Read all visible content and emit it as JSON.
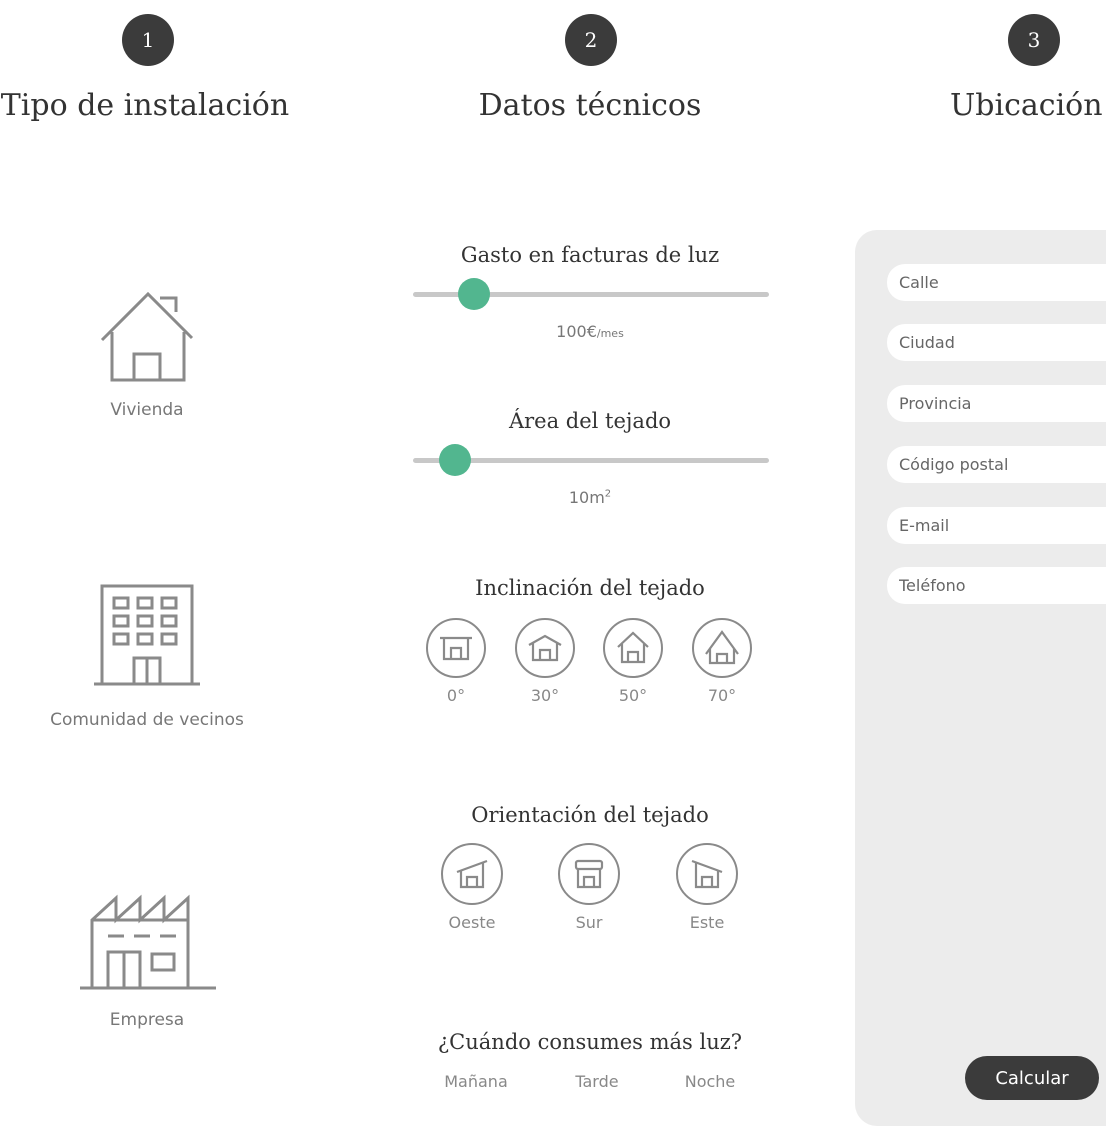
{
  "steps": [
    {
      "number": "1",
      "title": "Tipo de instalación"
    },
    {
      "number": "2",
      "title": "Datos técnicos"
    },
    {
      "number": "3",
      "title": "Ubicación"
    }
  ],
  "installation_types": [
    {
      "label": "Vivienda",
      "icon": "house-icon"
    },
    {
      "label": "Comunidad de vecinos",
      "icon": "apartment-building-icon"
    },
    {
      "label": "Empresa",
      "icon": "factory-icon"
    }
  ],
  "technical": {
    "bill": {
      "title": "Gasto en facturas de luz",
      "value": "100€",
      "unit": "/mes",
      "level": 0.14
    },
    "roof_area": {
      "title": "Área del tejado",
      "value": "10m",
      "sup": "2",
      "level": 0.08
    },
    "inclination": {
      "title": "Inclinación del tejado",
      "options": [
        {
          "label": "0°",
          "icon": "flat-roof-icon"
        },
        {
          "label": "30°",
          "icon": "roof-30-icon"
        },
        {
          "label": "50°",
          "icon": "roof-50-icon"
        },
        {
          "label": "70°",
          "icon": "roof-70-icon"
        }
      ]
    },
    "orientation": {
      "title": "Orientación del tejado",
      "options": [
        {
          "label": "Oeste",
          "icon": "roof-west-icon"
        },
        {
          "label": "Sur",
          "icon": "roof-south-icon"
        },
        {
          "label": "Este",
          "icon": "roof-east-icon"
        }
      ]
    },
    "consumption": {
      "title": "¿Cuándo consumes más luz?",
      "options": [
        "Mañana",
        "Tarde",
        "Noche"
      ]
    }
  },
  "location": {
    "fields": [
      {
        "placeholder": "Calle"
      },
      {
        "placeholder": "Ciudad"
      },
      {
        "placeholder": "Provincia"
      },
      {
        "placeholder": "Código postal"
      },
      {
        "placeholder": "E-mail"
      },
      {
        "placeholder": "Teléfono"
      }
    ],
    "submit_label": "Calcular"
  },
  "colors": {
    "accent": "#52b68f",
    "dark": "#3b3b3b",
    "panel": "#ececec"
  }
}
